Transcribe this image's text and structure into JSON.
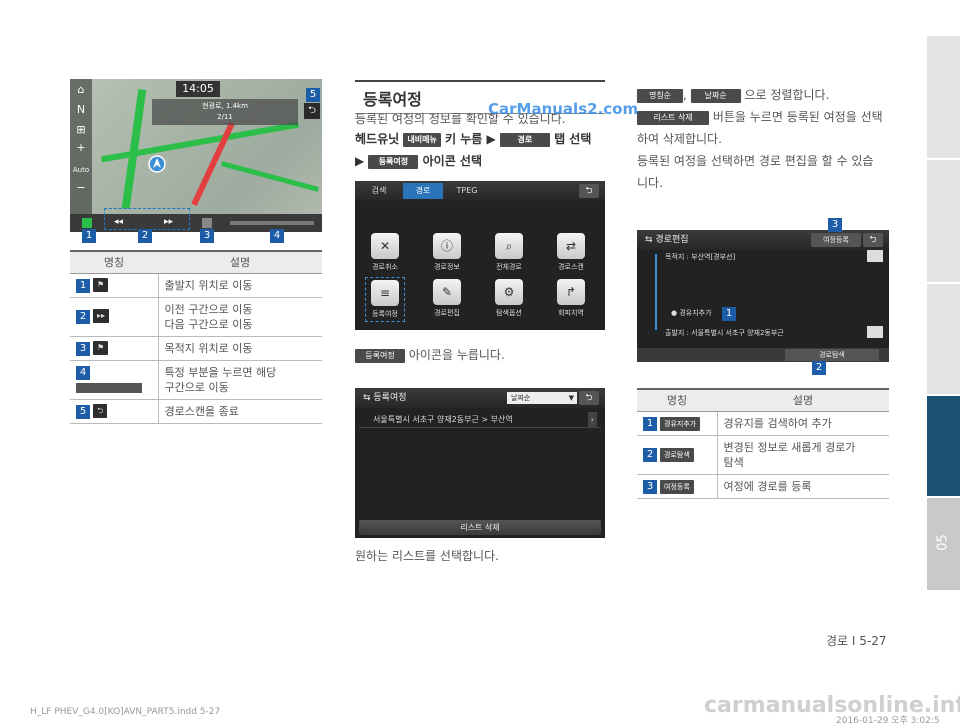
{
  "left": {
    "nav_screen": {
      "time": "14:05",
      "info_line1": "현광로, 1.4km",
      "info_line2": "2/11",
      "left_buttons": [
        "⌂",
        "N",
        "⊞",
        "+",
        "Auto",
        "−"
      ],
      "callouts": [
        "1",
        "2",
        "3",
        "4",
        "5"
      ]
    },
    "table": {
      "headers": [
        "명칭",
        "설명"
      ],
      "rows": [
        {
          "num": "1",
          "desc": "출발지 위치로 이동"
        },
        {
          "num": "2",
          "desc": "이전 구간으로 이동\n다음 구간으로 이동"
        },
        {
          "num": "3",
          "desc": "목적지 위치로 이동"
        },
        {
          "num": "4",
          "desc": "특정 부분을 누르면 해당\n구간으로 이동"
        },
        {
          "num": "5",
          "desc": "경로스캔을 종료"
        }
      ]
    }
  },
  "middle": {
    "section_title": "등록여정",
    "intro": "등록된 여정의 정보를 확인할 수 있습니다.",
    "step_prefix": "헤드유닛",
    "step_btn1": "내비메뉴",
    "step_key": "키 누름 ▶",
    "step_btn2": "경로",
    "step_tab": "탭 선택",
    "step2_arrow": "▶",
    "step2_btn": "등록여정",
    "step2_text": "아이콘 선택",
    "menu_screen": {
      "tabs": [
        "검색",
        "경로",
        "TPEG"
      ],
      "icons": [
        "경로취소",
        "경로정보",
        "전체경로",
        "경로스캔",
        "등록여정",
        "경로편집",
        "탐색옵션",
        "회피지역"
      ]
    },
    "note_btn": "등록여정",
    "note_text": "아이콘을 누릅니다.",
    "list_screen": {
      "title": "등록여정",
      "sort": "날짜순",
      "row": "서울특별시 서초구 양재2동부근 > 부산역",
      "delete_btn": "리스트 삭제"
    },
    "bottom_text": "원하는 리스트를 선택합니다."
  },
  "right": {
    "sort_btn1": "명칭순",
    "sort_btn2": "날짜순",
    "sort_text": "으로 정렬합니다.",
    "del_btn": "리스트 삭제",
    "del_text1": "버튼을 누르면 등록된 여정을 선택",
    "del_text2": "하여 삭제합니다.",
    "edit_text1": "등록된 여정을 선택하면 경로 편집을 할 수 있습",
    "edit_text2": "니다.",
    "edit_screen": {
      "title": "경로편집",
      "register_btn": "여정등록",
      "dest": "목적지 : 부산역[경부선]",
      "waypoint": "경유지추가",
      "origin": "출발지 : 서울특별시 서초구 양재2동부근",
      "search_btn": "경로탐색",
      "callouts": [
        "3",
        "1",
        "2"
      ]
    },
    "table": {
      "headers": [
        "명칭",
        "설명"
      ],
      "rows": [
        {
          "num": "1",
          "btn": "경유지추가",
          "desc": "경유지를 검색하여 추가"
        },
        {
          "num": "2",
          "btn": "경로탐색",
          "desc": "변경된 정보로 새롭게 경로가\n탐색"
        },
        {
          "num": "3",
          "btn": "여정등록",
          "desc": "여정에 경로를 등록"
        }
      ]
    }
  },
  "side_tab": "05",
  "watermark": "CarManuals2.com",
  "page_number": "경로 I 5-27",
  "footer_left": "H_LF PHEV_G4.0[KO]AVN_PART5.indd   5-27",
  "footer_right": "2016-01-29   오후 3:02:5",
  "logo": "carmanualsonline.info"
}
